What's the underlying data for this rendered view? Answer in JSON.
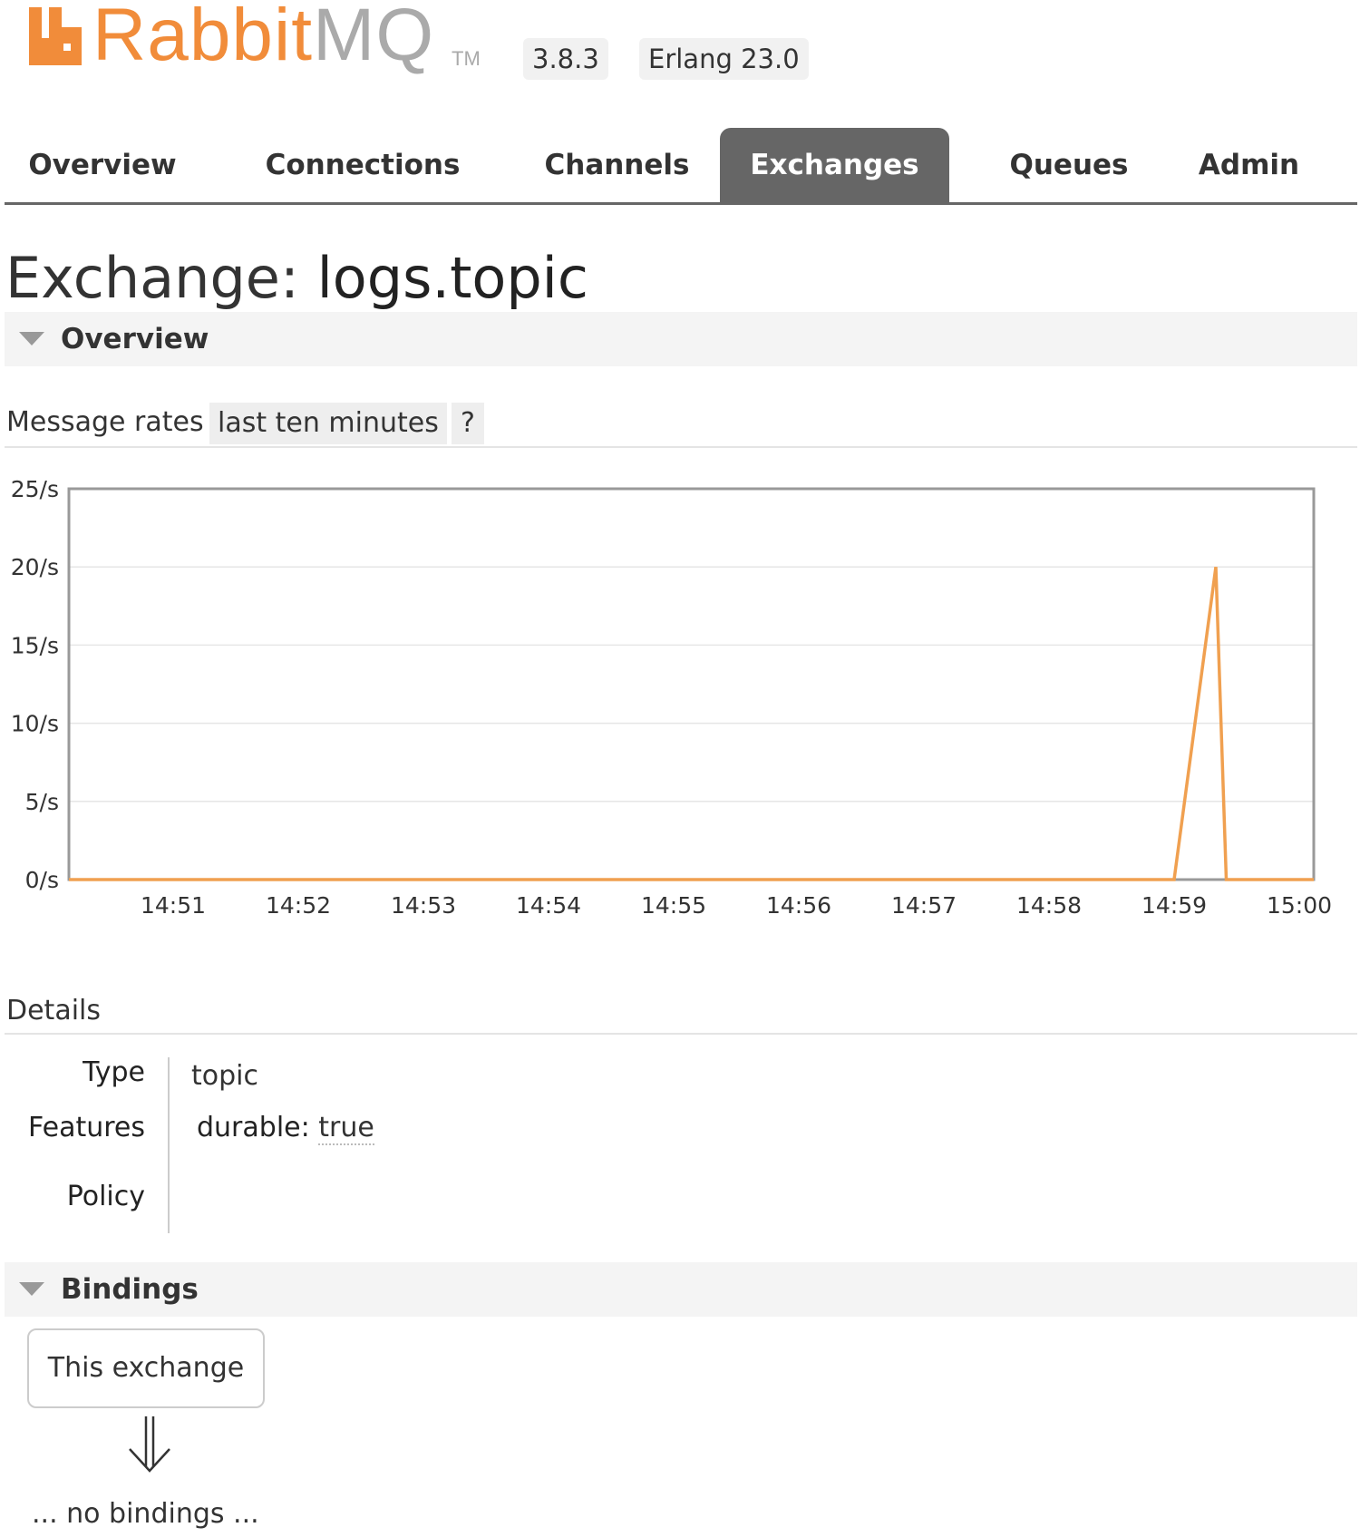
{
  "brand": {
    "name_part1": "Rabbit",
    "name_part2": "MQ",
    "tm": "TM",
    "version": "3.8.3",
    "erlang": "Erlang 23.0",
    "colors": {
      "orange": "#f18c3a",
      "grey": "#aaaaaa"
    }
  },
  "nav": {
    "tabs": [
      {
        "label": "Overview"
      },
      {
        "label": "Connections"
      },
      {
        "label": "Channels"
      },
      {
        "label": "Exchanges",
        "active": true
      },
      {
        "label": "Queues"
      },
      {
        "label": "Admin"
      }
    ]
  },
  "page": {
    "title_label": "Exchange:",
    "title_name": "logs.topic"
  },
  "overview": {
    "section_title": "Overview",
    "rates_label": "Message rates",
    "rates_range": "last ten minutes",
    "help": "?"
  },
  "chart_data": {
    "type": "line",
    "y_tick_labels": [
      "25/s",
      "20/s",
      "15/s",
      "10/s",
      "5/s",
      "0/s"
    ],
    "y_ticks": [
      25,
      20,
      15,
      10,
      5,
      0
    ],
    "ylim": [
      0,
      25
    ],
    "x_tick_labels": [
      "14:51",
      "14:52",
      "14:53",
      "14:54",
      "14:55",
      "14:56",
      "14:57",
      "14:58",
      "14:59",
      "15:00"
    ],
    "grid": true,
    "series": [
      {
        "color": "#f0a050",
        "points": [
          {
            "x": "14:50:10",
            "y": 0
          },
          {
            "x": "14:59:00",
            "y": 0
          },
          {
            "x": "14:59:20",
            "y": 20
          },
          {
            "x": "14:59:25",
            "y": 0
          },
          {
            "x": "15:00:10",
            "y": 0
          }
        ]
      }
    ]
  },
  "details": {
    "heading": "Details",
    "type_key": "Type",
    "type_val": "topic",
    "features_key": "Features",
    "feature_name": "durable:",
    "feature_val": "true",
    "policy_key": "Policy"
  },
  "bindings": {
    "section_title": "Bindings",
    "this_exchange": "This exchange",
    "no_bindings": "... no bindings ..."
  }
}
